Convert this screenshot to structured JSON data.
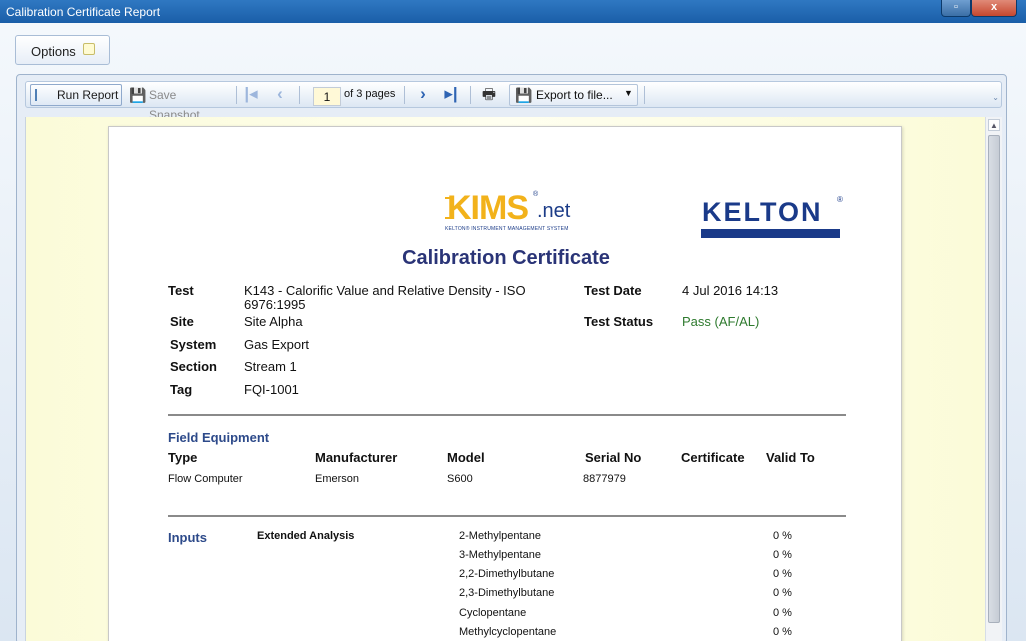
{
  "window": {
    "title": "Calibration Certificate Report",
    "restore_glyph": "▫",
    "close_glyph": "x"
  },
  "options": {
    "label": "Options"
  },
  "toolbar": {
    "run_label": "Run Report",
    "snapshot_label": "Save Snapshot",
    "current_page": "1",
    "page_suffix": "of 3 pages",
    "export_label": "Export to file..."
  },
  "report": {
    "kims_logo": {
      "main": "KIMS",
      "net": ".net",
      "tagline": "KELTON® INSTRUMENT MANAGEMENT SYSTEM"
    },
    "kelton_logo": "KELTON",
    "title": "Calibration Certificate",
    "fields": {
      "test_label": "Test",
      "test_value": "K143 - Calorific Value and Relative Density - ISO 6976:1995",
      "site_label": "Site",
      "site_value": "Site Alpha",
      "system_label": "System",
      "system_value": "Gas Export",
      "section_label": "Section",
      "section_value": "Stream 1",
      "tag_label": "Tag",
      "tag_value": "FQI-1001",
      "date_label": "Test Date",
      "date_value": "4 Jul 2016 14:13",
      "status_label": "Test Status",
      "status_value": "Pass (AF/AL)"
    },
    "field_equipment": {
      "title": "Field Equipment",
      "headers": [
        "Type",
        "Manufacturer",
        "Model",
        "Serial No",
        "Certificate",
        "Valid To"
      ],
      "row": [
        "Flow Computer",
        "Emerson",
        "S600",
        "8877979",
        "",
        ""
      ]
    },
    "inputs": {
      "title": "Inputs",
      "group": "Extended Analysis",
      "components": [
        {
          "name": "2-Methylpentane",
          "value": "0 %"
        },
        {
          "name": "3-Methylpentane",
          "value": "0 %"
        },
        {
          "name": "2,2-Dimethylbutane",
          "value": "0 %"
        },
        {
          "name": "2,3-Dimethylbutane",
          "value": "0 %"
        },
        {
          "name": "Cyclopentane",
          "value": "0 %"
        },
        {
          "name": "Methylcyclopentane",
          "value": "0 %"
        }
      ]
    }
  }
}
